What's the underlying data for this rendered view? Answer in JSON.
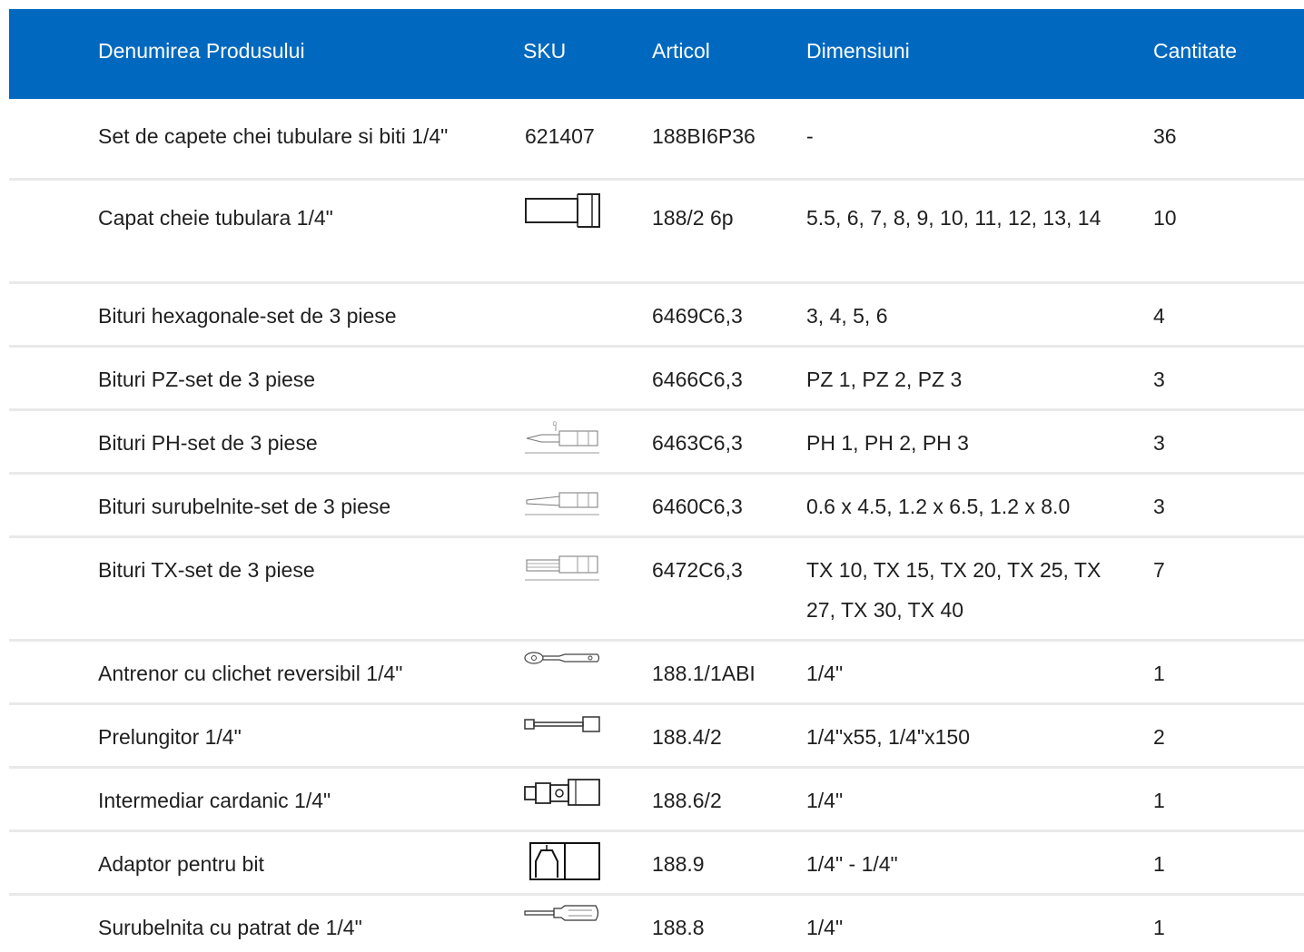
{
  "header": {
    "name": "Denumirea Produsului",
    "sku": "SKU",
    "article": "Articol",
    "dimensions": "Dimensiuni",
    "quantity": "Cantitate"
  },
  "rows": [
    {
      "name": "Set de capete chei tubulare si biti 1/4\"",
      "sku": "621407",
      "article": "188BI6P36",
      "dimensions": "-",
      "quantity": "36",
      "icon": ""
    },
    {
      "name": "Capat cheie tubulara 1/4\"",
      "sku": "",
      "article": "188/2 6p",
      "dimensions": "5.5, 6, 7, 8, 9, 10, 11, 12, 13, 14",
      "quantity": "10",
      "icon": "socket-icon"
    },
    {
      "name": "Bituri hexagonale-set de 3 piese",
      "sku": "",
      "article": "6469C6,3",
      "dimensions": "3, 4, 5, 6",
      "quantity": "4",
      "icon": ""
    },
    {
      "name": "Bituri PZ-set de 3 piese",
      "sku": "",
      "article": "6466C6,3",
      "dimensions": "PZ 1, PZ 2, PZ 3",
      "quantity": "3",
      "icon": ""
    },
    {
      "name": "Bituri PH-set de 3 piese",
      "sku": "",
      "article": "6463C6,3",
      "dimensions": "PH 1, PH 2, PH 3",
      "quantity": "3",
      "icon": "ph-bit-icon"
    },
    {
      "name": "Bituri surubelnite-set de 3 piese",
      "sku": "",
      "article": "6460C6,3",
      "dimensions": "0.6 x 4.5, 1.2 x 6.5, 1.2 x 8.0",
      "quantity": "3",
      "icon": "flat-bit-icon"
    },
    {
      "name": "Bituri TX-set de 3 piese",
      "sku": "",
      "article": "6472C6,3",
      "dimensions": "TX 10, TX 15, TX 20, TX 25, TX 27, TX 30, TX 40",
      "quantity": "7",
      "icon": "tx-bit-icon"
    },
    {
      "name": "Antrenor cu clichet reversibil 1/4\"",
      "sku": "",
      "article": "188.1/1ABI",
      "dimensions": "1/4\"",
      "quantity": "1",
      "icon": "ratchet-icon"
    },
    {
      "name": "Prelungitor 1/4\"",
      "sku": "",
      "article": "188.4/2",
      "dimensions": "1/4\"x55, 1/4\"x150",
      "quantity": "2",
      "icon": "extension-bar-icon"
    },
    {
      "name": "Intermediar cardanic 1/4\"",
      "sku": "",
      "article": "188.6/2",
      "dimensions": "1/4\"",
      "quantity": "1",
      "icon": "universal-joint-icon"
    },
    {
      "name": "Adaptor pentru bit",
      "sku": "",
      "article": "188.9",
      "dimensions": "1/4\" - 1/4\"",
      "quantity": "1",
      "icon": "bit-adapter-icon"
    },
    {
      "name": "Surubelnita cu patrat de 1/4\"",
      "sku": "",
      "article": "188.8",
      "dimensions": "1/4\"",
      "quantity": "1",
      "icon": "screwdriver-icon"
    }
  ]
}
